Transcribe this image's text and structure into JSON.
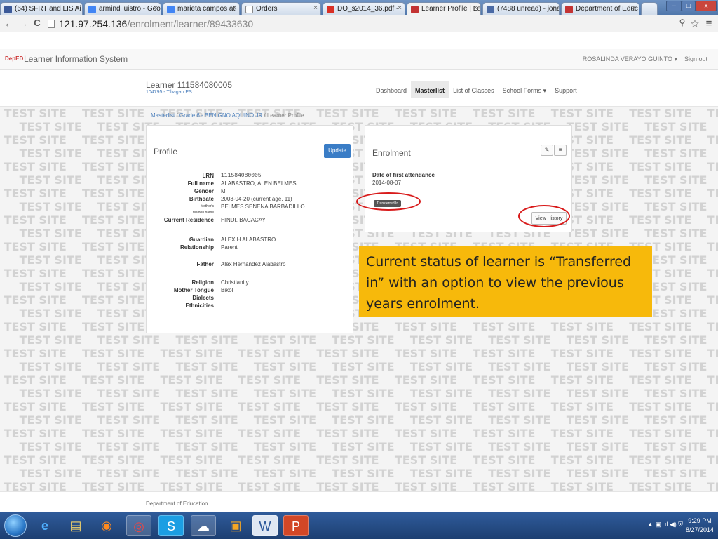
{
  "browser": {
    "tabs": [
      {
        "label": "(64) SFRT and LIS Ai",
        "color": "#3b5998"
      },
      {
        "label": "armind luistro - Goo",
        "color": "#4285f4"
      },
      {
        "label": "marieta campos ati",
        "color": "#4285f4"
      },
      {
        "label": "Orders",
        "color": "#ffffff"
      },
      {
        "label": "DO_s2014_36.pdf - ",
        "color": "#d93025"
      },
      {
        "label": "Learner Profile | Lea",
        "color": "#c33333"
      },
      {
        "label": "(7488 unread) - jona",
        "color": "#4a6aa5"
      },
      {
        "label": "Department of Educ",
        "color": "#c33333"
      }
    ],
    "url_host": "121.97.254.136",
    "url_path": "/enrolment/learner/89433630",
    "back_icon": "←",
    "forward_icon": "→",
    "reload_icon": "C",
    "zoom_icon": "⚲",
    "star_icon": "☆",
    "menu_icon": "≡",
    "minimize": "–",
    "maximize": "□",
    "close": "x"
  },
  "app": {
    "logo": "DepED",
    "title": "Learner Information System",
    "user": "ROSALINDA VERAYO GUINTO ▾",
    "signout": "Sign out"
  },
  "subheader": {
    "learner_title": "Learner 111584080005",
    "school": "104795 - Tibagan ES",
    "nav": [
      {
        "label": "Dashboard",
        "active": false
      },
      {
        "label": "Masterlist",
        "active": true
      },
      {
        "label": "List of Classes",
        "active": false
      },
      {
        "label": "School Forms ▾",
        "active": false
      },
      {
        "label": "Support",
        "active": false
      }
    ]
  },
  "breadcrumb": {
    "masterlist": "Masterlist",
    "sep1": " / ",
    "section": "Grade 6 - BENIGNO AQUINO JR",
    "sep2": " / ",
    "current": "Learner Profile"
  },
  "watermark_text": "TEST SITE",
  "profile": {
    "heading": "Profile",
    "update_label": "Update",
    "fields": {
      "lrn_label": "LRN",
      "lrn": "111584080005",
      "fullname_label": "Full name",
      "fullname": "ALABASTRO, ALEN BELMES",
      "gender_label": "Gender",
      "gender": "M",
      "birthdate_label": "Birthdate",
      "birthdate": "2003-04-20 (current age, 11)",
      "mother_label": "Mother's",
      "mother_label2": "Maiden name",
      "mother": "BELMES SENENA BARBADILLO",
      "residence_label": "Current Residence",
      "residence": "HINDI, BACACAY",
      "guardian_label": "Guardian",
      "guardian": "ALEX H ALABASTRO",
      "relationship_label": "Relationship",
      "relationship": "Parent",
      "father_label": "Father",
      "father": "Alex Hernandez Alabastro",
      "religion_label": "Religion",
      "religion": "Christianity",
      "tongue_label": "Mother Tongue",
      "tongue": "Bikol",
      "dialects_label": "Dialects",
      "ethnicities_label": "Ethnicities"
    }
  },
  "enrolment": {
    "heading": "Enrolment",
    "edit_icon": "✎",
    "list_icon": "≡",
    "first_attendance_label": "Date of first attendance",
    "first_attendance": "2014-08-07",
    "status_badge": "Transferred In",
    "view_history": "View History"
  },
  "callout": "Current status of learner is “Transferred in” with an option to view the previous years enrolment.",
  "footer": "Department of Education",
  "taskbar": {
    "icons": [
      "ie-icon",
      "explorer-icon",
      "firefox-icon",
      "chrome-icon",
      "skype-icon",
      "cloud-icon",
      "media-icon",
      "word-icon",
      "powerpoint-icon"
    ],
    "tray": "▲  ▣  .ıl  ◀)  ⛨",
    "time": "9:29 PM",
    "date": "8/27/2014"
  },
  "colors": {
    "accent": "#3a7dc6",
    "callout": "#f7b90b",
    "highlight": "#d81a1a",
    "watermark": "#d2d2d2"
  }
}
